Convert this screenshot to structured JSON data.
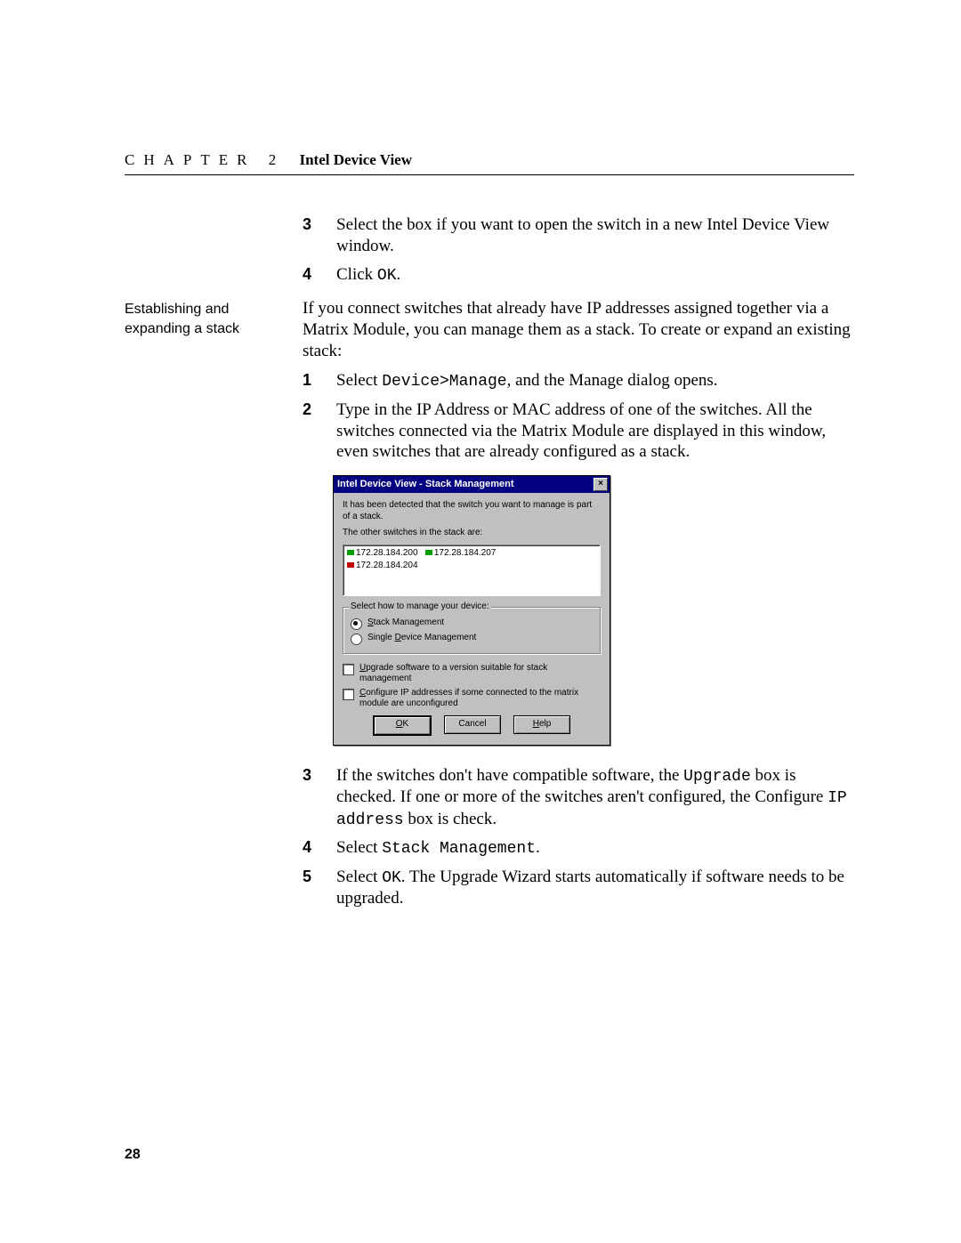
{
  "header": {
    "chapter_label": "CHAPTER 2",
    "chapter_title": "Intel Device View"
  },
  "sidebar": {
    "heading": "Establishing and expanding a stack"
  },
  "section1": {
    "steps": [
      {
        "n": "3",
        "text_a": "Select the box if you want to open the switch in a new Intel Device View window."
      },
      {
        "n": "4",
        "text_a": "Click ",
        "code_a": "OK",
        "text_b": "."
      }
    ]
  },
  "section2": {
    "intro": "If you connect switches that already have IP addresses assigned together via a Matrix Module, you can manage them as a stack. To create or expand an existing stack:",
    "steps_a": [
      {
        "n": "1",
        "text_a": "Select ",
        "code_a": "Device>Manage",
        "text_b": ", and the Manage dialog opens."
      },
      {
        "n": "2",
        "text_a": "Type in the IP Address or MAC address of one of the switches. All the switches connected via the Matrix Module are displayed in this window, even switches that are already configured as a stack."
      }
    ],
    "steps_b": [
      {
        "n": "3",
        "text_a": "If the switches don't have compatible software, the ",
        "code_a": "Upgrade",
        "text_b": " box is checked. If one or more of the switches aren't configured, the Configure ",
        "code_b": "IP address",
        "text_c": " box is check."
      },
      {
        "n": "4",
        "text_a": "Select ",
        "code_a": "Stack Management",
        "text_b": "."
      },
      {
        "n": "5",
        "text_a": "Select ",
        "code_a": "OK",
        "text_b": ". The Upgrade Wizard starts automatically if software needs to be upgraded."
      }
    ]
  },
  "dialog": {
    "title": "Intel Device View - Stack Management",
    "close": "×",
    "msg1": "It has been detected that the switch you want to manage is part of a stack.",
    "msg2": "The other switches in the stack are:",
    "ips": [
      "172.28.184.200",
      "172.28.184.207",
      "172.28.184.204"
    ],
    "group_legend": "Select how to manage your device:",
    "radio_stack": "Stack Management",
    "radio_single": "Single Device Management",
    "chk_upgrade": "Upgrade software to a version suitable for stack management",
    "chk_configure": "Configure IP addresses if some connected to the matrix module are unconfigured",
    "btn_ok": "OK",
    "btn_cancel": "Cancel",
    "btn_help": "Help"
  },
  "page_number": "28"
}
